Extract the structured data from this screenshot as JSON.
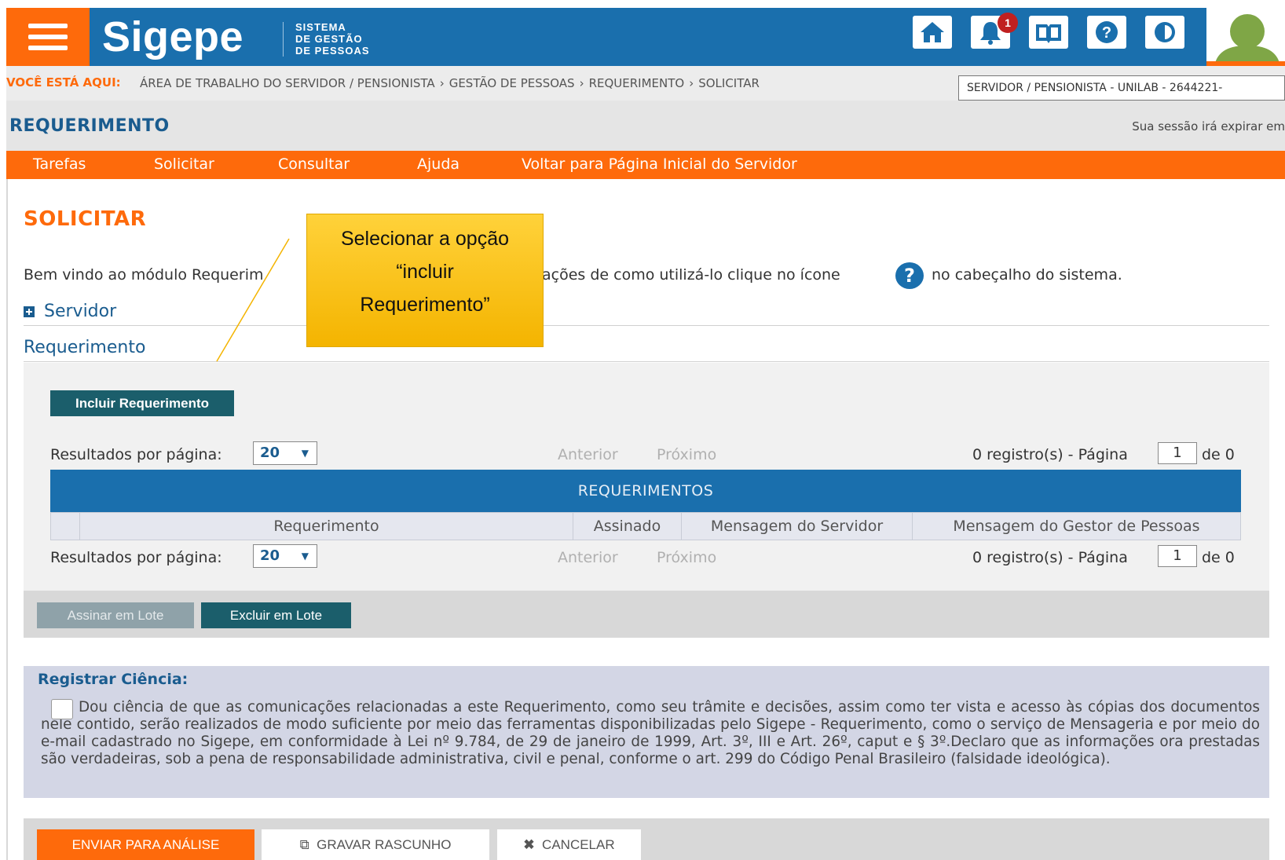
{
  "header": {
    "logo": "Sigepe",
    "subtitle_lines": [
      "SISTEMA",
      "DE GESTÃO",
      "DE PESSOAS"
    ],
    "notification_count": "1",
    "icons": [
      "home-icon",
      "bell-icon",
      "book-icon",
      "help-icon",
      "contrast-icon"
    ]
  },
  "breadcrumb": {
    "lead": "VOCÊ ESTÁ AQUI:",
    "items": [
      "ÁREA DE TRABALHO DO SERVIDOR / PENSIONISTA",
      "GESTÃO DE PESSOAS",
      "REQUERIMENTO",
      "SOLICITAR"
    ],
    "user_select": "SERVIDOR / PENSIONISTA - UNILAB - 2644221-"
  },
  "module": {
    "title": "REQUERIMENTO",
    "session": "Sua sessão irá expirar em"
  },
  "nav": [
    "Tarefas",
    "Solicitar",
    "Consultar",
    "Ajuda",
    "Voltar para Página Inicial do Servidor"
  ],
  "page": {
    "title": "SOLICITAR",
    "welcome_start": "Bem vindo ao módulo Requerim",
    "welcome_mid": "ações de como utilizá-lo clique no ícone",
    "welcome_end": "no cabeçalho do sistema.",
    "section_servidor": "Servidor",
    "section_requerimento": "Requerimento"
  },
  "requerimentos": {
    "incluir_button": "Incluir Requerimento",
    "results_label": "Resultados por página:",
    "page_size": "20",
    "prev": "Anterior",
    "next": "Próximo",
    "records": "0 registro(s) - Página",
    "current_page": "1",
    "of": "de 0",
    "table_title": "REQUERIMENTOS",
    "columns": [
      "Requerimento",
      "Assinado",
      "Mensagem do Servidor",
      "Mensagem do Gestor de Pessoas"
    ]
  },
  "batch": {
    "sign": "Assinar em Lote",
    "delete": "Excluir em Lote"
  },
  "ciencia": {
    "title": "Registrar Ciência:",
    "text": "Dou ciência de que as comunicações relacionadas a este Requerimento, como seu trâmite e decisões, assim como ter vista e acesso às cópias dos documentos nele contido, serão realizados de modo suficiente por meio das ferramentas disponibilizadas pelo Sigepe - Requerimento, como o serviço de Mensageria e por meio do e-mail cadastrado no Sigepe, em conformidade à Lei nº 9.784, de 29 de janeiro de 1999, Art. 3º, III e Art. 26º, caput e § 3º.Declaro que as informações ora prestadas são verdadeiras, sob a pena de responsabilidade administrativa, civil e penal, conforme o art. 299 do Código Penal Brasileiro (falsidade ideológica)."
  },
  "actions": {
    "send": "ENVIAR PARA ANÁLISE",
    "draft": "GRAVAR RASCUNHO",
    "cancel": "CANCELAR"
  },
  "callout": {
    "lines": [
      "Selecionar a opção",
      "“incluir",
      "Requerimento”"
    ]
  },
  "colors": {
    "orange": "#fe6a0b",
    "blue": "#1a6fad",
    "teal_button": "#1b5e6b",
    "callout_yellow": "#ffc91c"
  }
}
